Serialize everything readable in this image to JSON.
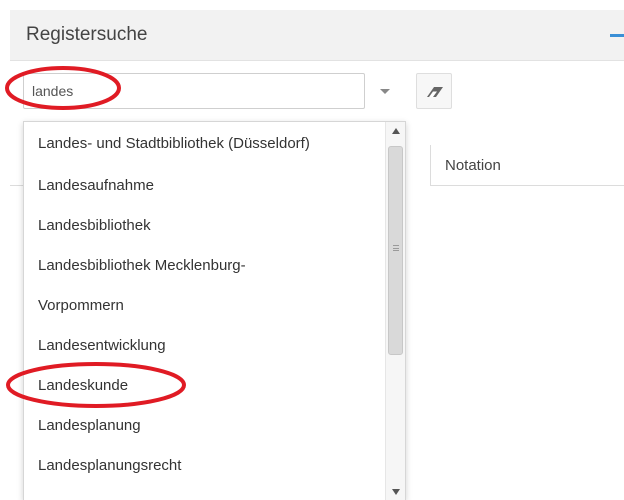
{
  "panel": {
    "title": "Registersuche"
  },
  "search": {
    "value": "landes"
  },
  "table": {
    "columns": [
      "Notation"
    ]
  },
  "dropdown": {
    "options": [
      "Landes- und Stadtbibliothek (Düsseldorf)",
      "Landesaufnahme",
      "Landesbibliothek",
      "Landesbibliothek Mecklenburg-",
      "Vorpommern",
      "Landesentwicklung",
      "Landeskunde",
      "Landesplanung",
      "Landesplanungsrecht"
    ]
  },
  "colors": {
    "accent": "#3a8fd6",
    "annotation": "#e01b24"
  },
  "icons": {
    "collapse": "minus-icon",
    "toggle": "caret-down-icon",
    "clear": "eraser-icon"
  }
}
